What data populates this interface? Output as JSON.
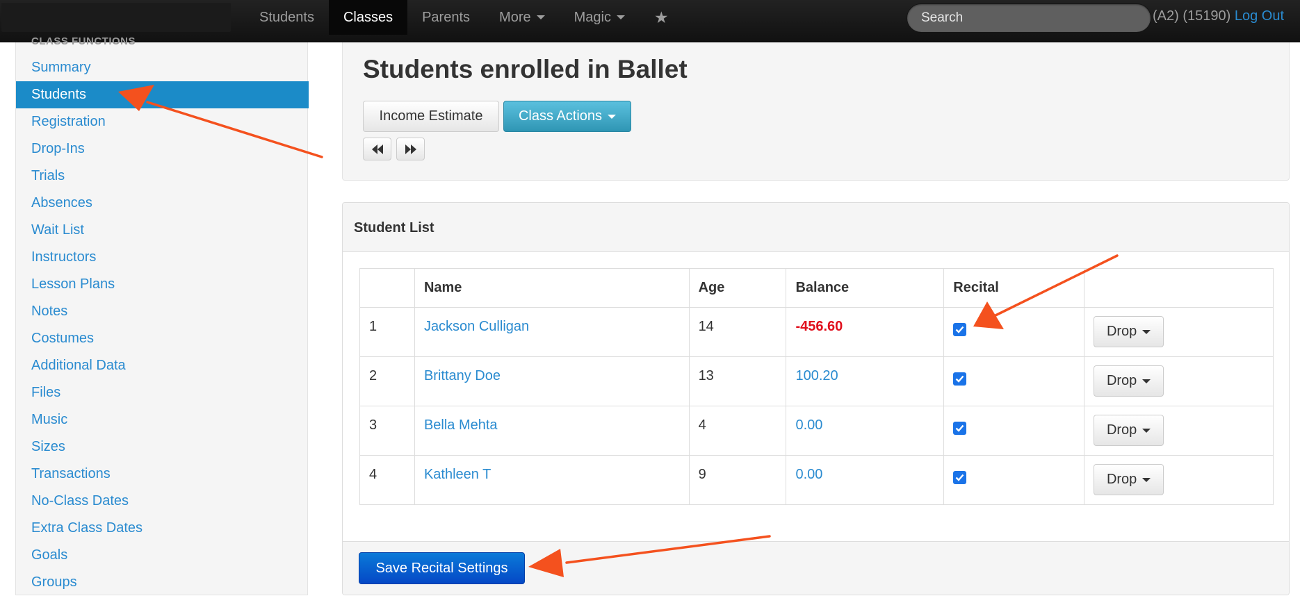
{
  "navbar": {
    "items": [
      {
        "label": "Students",
        "active": false
      },
      {
        "label": "Classes",
        "active": true
      },
      {
        "label": "Parents",
        "active": false
      },
      {
        "label": "More",
        "active": false
      },
      {
        "label": "Magic",
        "active": false
      }
    ],
    "star_icon": "star-icon",
    "search_placeholder": "Search",
    "account_info": "(A2) (15190)",
    "logout_label": "Log Out"
  },
  "sidebar": {
    "header": "CLASS FUNCTIONS",
    "items": [
      {
        "label": "Summary",
        "active": false
      },
      {
        "label": "Students",
        "active": true
      },
      {
        "label": "Registration",
        "active": false
      },
      {
        "label": "Drop-Ins",
        "active": false
      },
      {
        "label": "Trials",
        "active": false
      },
      {
        "label": "Absences",
        "active": false
      },
      {
        "label": "Wait List",
        "active": false
      },
      {
        "label": "Instructors",
        "active": false
      },
      {
        "label": "Lesson Plans",
        "active": false
      },
      {
        "label": "Notes",
        "active": false
      },
      {
        "label": "Costumes",
        "active": false
      },
      {
        "label": "Additional Data",
        "active": false
      },
      {
        "label": "Files",
        "active": false
      },
      {
        "label": "Music",
        "active": false
      },
      {
        "label": "Sizes",
        "active": false
      },
      {
        "label": "Transactions",
        "active": false
      },
      {
        "label": "No-Class Dates",
        "active": false
      },
      {
        "label": "Extra Class Dates",
        "active": false
      },
      {
        "label": "Goals",
        "active": false
      },
      {
        "label": "Groups",
        "active": false
      }
    ]
  },
  "main": {
    "title": "Students enrolled in Ballet",
    "income_estimate_label": "Income Estimate",
    "class_actions_label": "Class Actions",
    "prev_icon": "fast-backward-icon",
    "next_icon": "fast-forward-icon"
  },
  "student_list": {
    "title": "Student List",
    "columns": [
      "",
      "Name",
      "Age",
      "Balance",
      "Recital",
      ""
    ],
    "rows": [
      {
        "num": "1",
        "name": "Jackson Culligan",
        "age": "14",
        "balance": "-456.60",
        "negative": true,
        "recital": true,
        "action": "Drop"
      },
      {
        "num": "2",
        "name": "Brittany Doe",
        "age": "13",
        "balance": "100.20",
        "negative": false,
        "recital": true,
        "action": "Drop"
      },
      {
        "num": "3",
        "name": "Bella Mehta",
        "age": "4",
        "balance": "0.00",
        "negative": false,
        "recital": true,
        "action": "Drop"
      },
      {
        "num": "4",
        "name": "Kathleen T",
        "age": "9",
        "balance": "0.00",
        "negative": false,
        "recital": true,
        "action": "Drop"
      }
    ],
    "save_label": "Save Recital Settings"
  },
  "colors": {
    "accent": "#1b8bc8",
    "link": "#2a8bd0",
    "negative": "#e0101d",
    "annotation_arrow": "#f4511e"
  }
}
